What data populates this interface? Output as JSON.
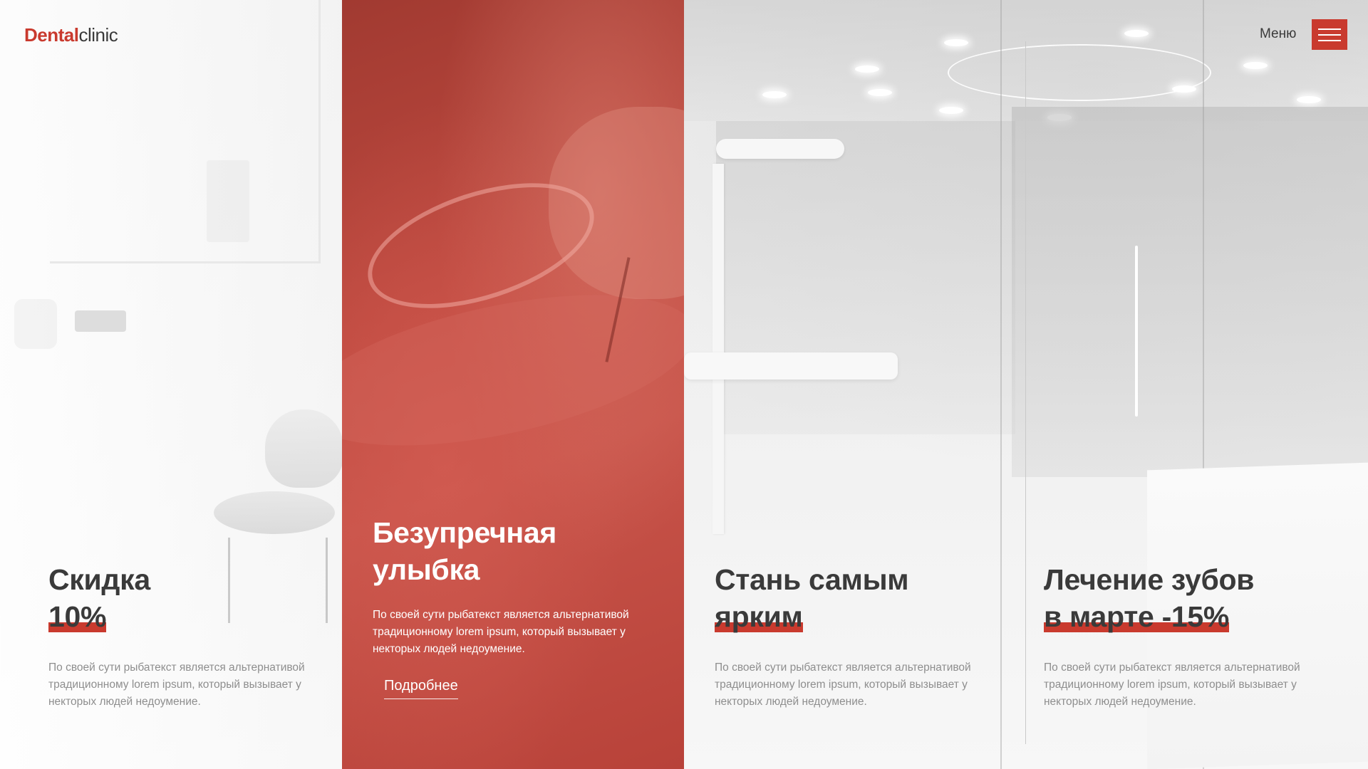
{
  "header": {
    "logo_bold": "Dental",
    "logo_light": "clinic",
    "menu_label": "Меню"
  },
  "colors": {
    "accent": "#c93a2e",
    "heading": "#3a3a3a",
    "body_text": "#8e8e8e"
  },
  "icons": {
    "menu": "hamburger-icon"
  },
  "columns": [
    {
      "title_line1": "Скидка",
      "title_line2": "10%",
      "text": "По своей сути рыбатекст является альтернативой традиционному lorem ipsum, который вызывает у некторых людей недоумение."
    },
    {
      "title_line1": "Безупречная",
      "title_line2": "улыбка",
      "text": "По своей сути рыбатекст является альтернативой традиционному lorem ipsum, который вызывает у некторых людей недоумение.",
      "link": "Подробнее"
    },
    {
      "title_line1": "Стань самым",
      "title_line2": "ярким",
      "text": "По своей сути рыбатекст является альтернативой традиционному lorem ipsum, который вызывает у некторых людей недоумение."
    },
    {
      "title_line1": "Лечение зубов",
      "title_line2": "в марте -15%",
      "text": "По своей сути рыбатекст является альтернативой традиционному lorem ipsum, который вызывает у некторых людей недоумение."
    }
  ]
}
